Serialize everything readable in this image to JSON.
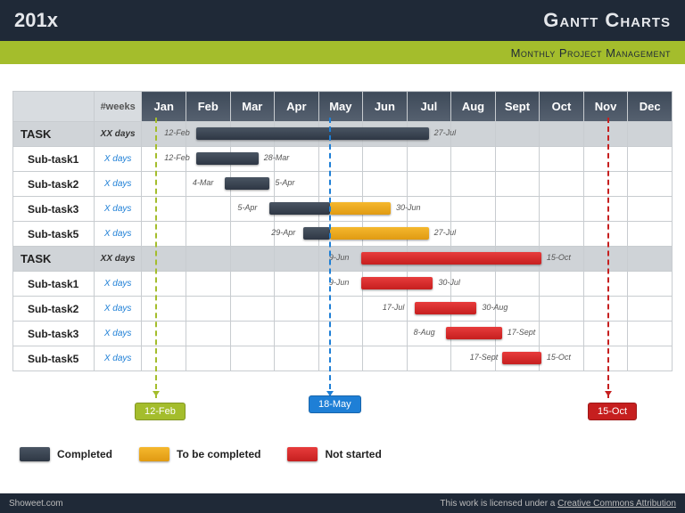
{
  "header": {
    "left": "201x",
    "right": "Gantt Charts"
  },
  "subheader": "Monthly Project Management",
  "columns": {
    "corner": "",
    "weeks": "#weeks",
    "months": [
      "Jan",
      "Feb",
      "Mar",
      "Apr",
      "May",
      "Jun",
      "Jul",
      "Aug",
      "Sept",
      "Oct",
      "Nov",
      "Dec"
    ]
  },
  "rows": [
    {
      "type": "main",
      "label": "TASK",
      "days": "XX days"
    },
    {
      "type": "sub",
      "label": "Sub-task1",
      "days": "X days"
    },
    {
      "type": "sub",
      "label": "Sub-task2",
      "days": "X days"
    },
    {
      "type": "sub",
      "label": "Sub-task3",
      "days": "X days"
    },
    {
      "type": "sub",
      "label": "Sub-task5",
      "days": "X days"
    },
    {
      "type": "main",
      "label": "TASK",
      "days": "XX days"
    },
    {
      "type": "sub",
      "label": "Sub-task1",
      "days": "X days"
    },
    {
      "type": "sub",
      "label": "Sub-task2",
      "days": "X days"
    },
    {
      "type": "sub",
      "label": "Sub-task3",
      "days": "X days"
    },
    {
      "type": "sub",
      "label": "Sub-task5",
      "days": "X days"
    }
  ],
  "markers": [
    {
      "color": "green",
      "date": "12-Feb"
    },
    {
      "color": "blue",
      "date": "18-May"
    },
    {
      "color": "red",
      "date": "15-Oct"
    }
  ],
  "legend": [
    {
      "color": "dark",
      "label": "Completed"
    },
    {
      "color": "orange",
      "label": "To be completed"
    },
    {
      "color": "red",
      "label": "Not started"
    }
  ],
  "footer": {
    "left": "Showeet.com",
    "right_prefix": "This work is licensed under a ",
    "right_link": "Creative Commons Attribution"
  },
  "chart_data": {
    "type": "gantt",
    "title": "Gantt Charts — Monthly Project Management",
    "x_axis": "months",
    "categories": [
      "Jan",
      "Feb",
      "Mar",
      "Apr",
      "May",
      "Jun",
      "Jul",
      "Aug",
      "Sept",
      "Oct",
      "Nov",
      "Dec"
    ],
    "today_marker": "18-May",
    "project_start_marker": "12-Feb",
    "project_end_marker": "15-Oct",
    "tasks": [
      {
        "name": "TASK",
        "level": 0,
        "start": "12-Feb",
        "end": "27-Jul",
        "segments": [
          {
            "status": "completed",
            "start": "12-Feb",
            "end": "27-Jul"
          }
        ]
      },
      {
        "name": "Sub-task1",
        "level": 1,
        "start": "12-Feb",
        "end": "28-Mar",
        "segments": [
          {
            "status": "completed",
            "start": "12-Feb",
            "end": "28-Mar"
          }
        ]
      },
      {
        "name": "Sub-task2",
        "level": 1,
        "start": "4-Mar",
        "end": "5-Apr",
        "segments": [
          {
            "status": "completed",
            "start": "4-Mar",
            "end": "5-Apr"
          }
        ]
      },
      {
        "name": "Sub-task3",
        "level": 1,
        "start": "5-Apr",
        "end": "30-Jun",
        "segments": [
          {
            "status": "completed",
            "start": "5-Apr",
            "end": "18-May"
          },
          {
            "status": "to_be_completed",
            "start": "18-May",
            "end": "30-Jun"
          }
        ]
      },
      {
        "name": "Sub-task5",
        "level": 1,
        "start": "29-Apr",
        "end": "27-Jul",
        "segments": [
          {
            "status": "completed",
            "start": "29-Apr",
            "end": "18-May"
          },
          {
            "status": "to_be_completed",
            "start": "18-May",
            "end": "27-Jul"
          }
        ]
      },
      {
        "name": "TASK",
        "level": 0,
        "start": "9-Jun",
        "end": "15-Oct",
        "segments": [
          {
            "status": "not_started",
            "start": "9-Jun",
            "end": "15-Oct"
          }
        ]
      },
      {
        "name": "Sub-task1",
        "level": 1,
        "start": "9-Jun",
        "end": "30-Jul",
        "segments": [
          {
            "status": "not_started",
            "start": "9-Jun",
            "end": "30-Jul"
          }
        ]
      },
      {
        "name": "Sub-task2",
        "level": 1,
        "start": "17-Jul",
        "end": "30-Aug",
        "segments": [
          {
            "status": "not_started",
            "start": "17-Jul",
            "end": "30-Aug"
          }
        ]
      },
      {
        "name": "Sub-task3",
        "level": 1,
        "start": "8-Aug",
        "end": "17-Sept",
        "segments": [
          {
            "status": "not_started",
            "start": "8-Aug",
            "end": "17-Sept"
          }
        ]
      },
      {
        "name": "Sub-task5",
        "level": 1,
        "start": "17-Sept",
        "end": "15-Oct",
        "segments": [
          {
            "status": "not_started",
            "start": "17-Sept",
            "end": "15-Oct"
          }
        ]
      }
    ],
    "legend": [
      {
        "status": "completed",
        "label": "Completed",
        "color": "#3a4553"
      },
      {
        "status": "to_be_completed",
        "label": "To be completed",
        "color": "#eca81e"
      },
      {
        "status": "not_started",
        "label": "Not started",
        "color": "#d22a2a"
      }
    ]
  }
}
